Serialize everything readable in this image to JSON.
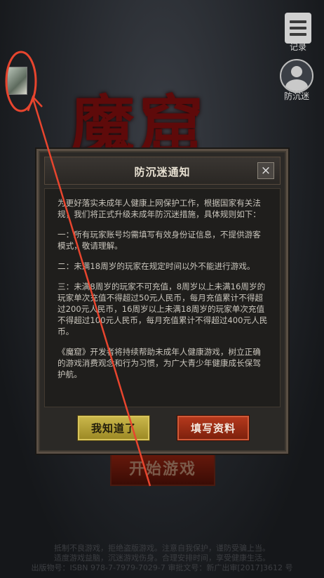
{
  "background": {
    "logo_text": "魔窟"
  },
  "side": {
    "record_label": "记录",
    "anti_addiction_label": "防沉迷"
  },
  "start_button": "开始游戏",
  "footer": {
    "line1": "抵制不良游戏，拒绝盗版游戏。注意自我保护，谨防受骗上当。",
    "line2": "适度游戏益脑，沉迷游戏伤身。合理安排时间，享受健康生活。",
    "line3": "出版物号：ISBN 978-7-7979-7029-7    审批文号：新广出审[2017]3612 号"
  },
  "dialog": {
    "title": "防沉迷通知",
    "close_symbol": "×",
    "paragraphs": [
      "为更好落实未成年人健康上网保护工作，根据国家有关法规，我们将正式升级未成年防沉迷措施，具体规则如下：",
      "一：所有玩家账号均需填写有效身份证信息，不提供游客模式，敬请理解。",
      "二：未满18周岁的玩家在规定时间以外不能进行游戏。",
      "三：未满8周岁的玩家不可充值，8周岁以上未满16周岁的玩家单次充值不得超过50元人民币，每月充值累计不得超过200元人民币，16周岁以上未满18周岁的玩家单次充值不得超过100元人民币，每月充值累计不得超过400元人民币。",
      "《魔窟》开发者将持续帮助未成年人健康游戏，树立正确的游戏消费观念和行为习惯，为广大青少年健康成长保驾护航。"
    ],
    "confirm_button": "我知道了",
    "fill_info_button": "填写资料"
  },
  "colors": {
    "annotation": "#e8452e",
    "confirm_button": "#b8a43a",
    "fill_info_button": "#a22f16"
  }
}
